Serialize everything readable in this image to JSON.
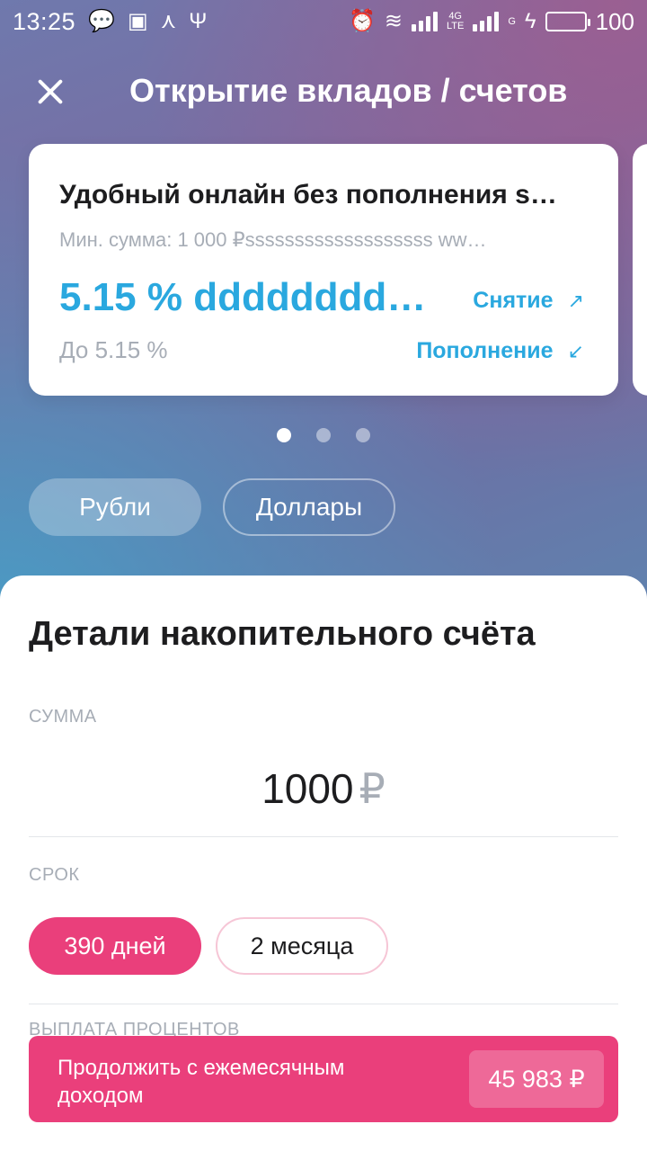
{
  "status_bar": {
    "time": "13:25",
    "battery": "100",
    "net1": "4G",
    "net1_sub": "LTE",
    "net2": "G"
  },
  "header": {
    "title": "Открытие вкладов / счетов"
  },
  "product_card": {
    "name": "Удобный онлайн без пополнения s…",
    "min_sum": "Мин. сумма: 1 000 ₽sssssssssssssssssss ww…",
    "rate": "5.15 % dddddddd…",
    "rate_upto": "До 5.15 %",
    "withdraw_label": "Снятие",
    "topup_label": "Пополнение"
  },
  "carousel": {
    "page_count": 3,
    "active_index": 0
  },
  "currency_tabs": [
    {
      "label": "Рубли",
      "selected": true
    },
    {
      "label": "Доллары",
      "selected": false
    }
  ],
  "details": {
    "title": "Детали накопительного счёта",
    "amount_label": "СУММА",
    "amount_value": "1000",
    "amount_currency": "₽",
    "term_label": "СРОК",
    "terms": [
      {
        "label": "390 дней",
        "selected": true
      },
      {
        "label": "2 месяца",
        "selected": false
      }
    ],
    "payout_label": "ВЫПЛАТА ПРОЦЕНТОВ"
  },
  "cta": {
    "label": "Продолжить с ежемесячным доходом",
    "price": "45 983 ₽"
  },
  "colors": {
    "accent_pink": "#ea3f7b",
    "accent_blue": "#2aa8df"
  }
}
